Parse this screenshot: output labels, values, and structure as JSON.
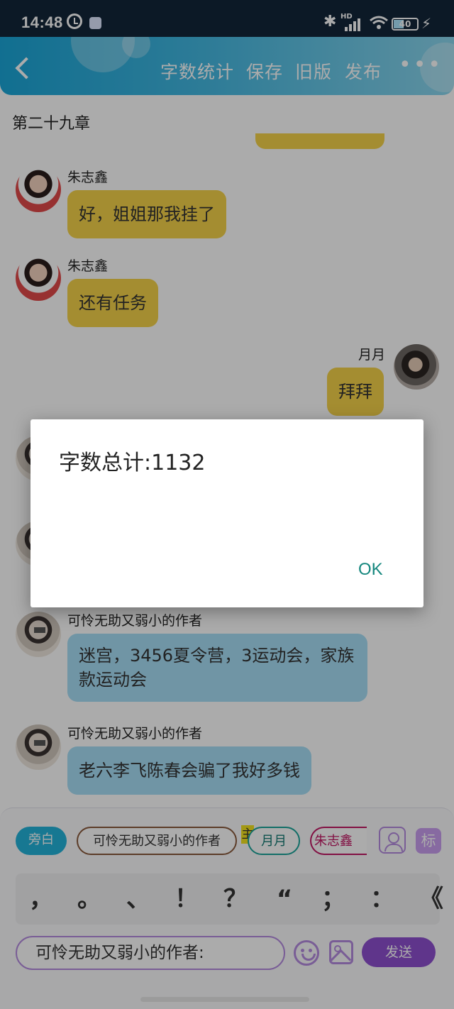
{
  "status_bar": {
    "time": "14:48",
    "network": "HD",
    "battery": "40",
    "icons": [
      "alarm-icon",
      "notification-icon",
      "bluetooth-icon",
      "signal-icon",
      "wifi-icon",
      "battery-icon",
      "charging-icon"
    ]
  },
  "toolbar": {
    "word_count": "字数统计",
    "save": "保存",
    "old_version": "旧版",
    "publish": "发布",
    "more": "•••"
  },
  "chapter_title": "第二十九章",
  "messages": [
    {
      "sender": "朱志鑫",
      "text": "好，姐姐那我挂了"
    },
    {
      "sender": "朱志鑫",
      "text": "还有任务"
    },
    {
      "sender": "月月",
      "text": "拜拜"
    },
    {
      "sender": "可怜无助又弱小的作者",
      "text": "迷宫，3456夏令营，3运动会，家族款运动会"
    },
    {
      "sender": "可怜无助又弱小的作者",
      "text": "老六李飞陈春会骗了我好多钱"
    }
  ],
  "roles": {
    "narration": "旁白",
    "author": "可怜无助又弱小的作者",
    "main_tag": "主",
    "yueyue": "月月",
    "zhu": "朱志鑫",
    "mark": "标"
  },
  "punctuation": [
    "，",
    "。",
    "、",
    "！",
    "？",
    "“",
    "；",
    "：",
    "《"
  ],
  "input": {
    "value": "可怜无助又弱小的作者:"
  },
  "send_label": "发送",
  "dialog": {
    "message": "字数总计:1132",
    "ok_label": "OK"
  },
  "colors": {
    "header": "#1aa6d8",
    "bubble_yellow": "#f5d24a",
    "bubble_blue": "#a8def7",
    "accent_purple": "#8e4fd0",
    "dialog_button": "#15877e"
  }
}
